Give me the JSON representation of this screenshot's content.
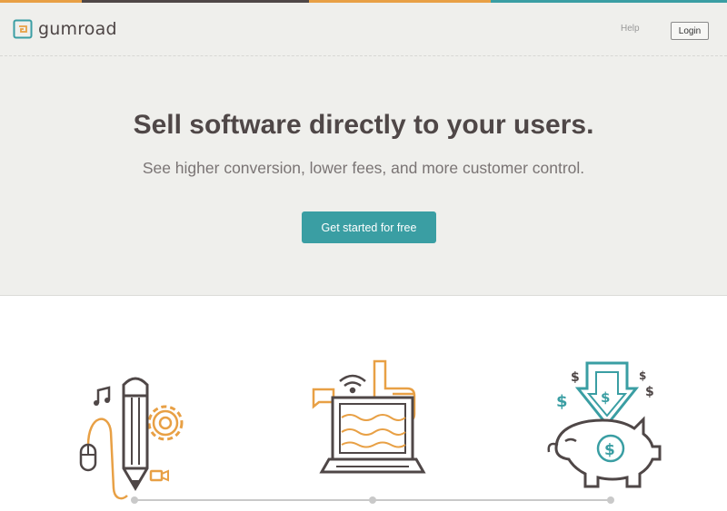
{
  "brand": {
    "name": "gumroad"
  },
  "nav": {
    "help_label": "Help",
    "login_label": "Login"
  },
  "hero": {
    "title": "Sell software directly to your users.",
    "subtitle": "See higher conversion, lower fees, and more customer control.",
    "cta_label": "Get started for free"
  },
  "illustrations": {
    "creator": "creator-tools-illustration",
    "fans": "fans-laptop-illustration",
    "money": "piggy-bank-illustration",
    "dollar_sign": "$"
  },
  "colors": {
    "accent": "#3a9ea3",
    "orange": "#e8a045",
    "dark": "#4f4747",
    "hero_bg": "#efefec",
    "stripe": [
      "#e8a045",
      "#3a9ea3",
      "#4f4747",
      "#e8a045"
    ]
  },
  "icons": [
    "logo-icon",
    "music-note-icon",
    "pencil-icon",
    "gear-icon",
    "mouse-icon",
    "video-camera-icon",
    "wifi-icon",
    "chat-bubble-icon",
    "thumbs-up-icon",
    "laptop-icon",
    "down-arrow-icon",
    "piggy-bank-icon",
    "dollar-icon"
  ]
}
